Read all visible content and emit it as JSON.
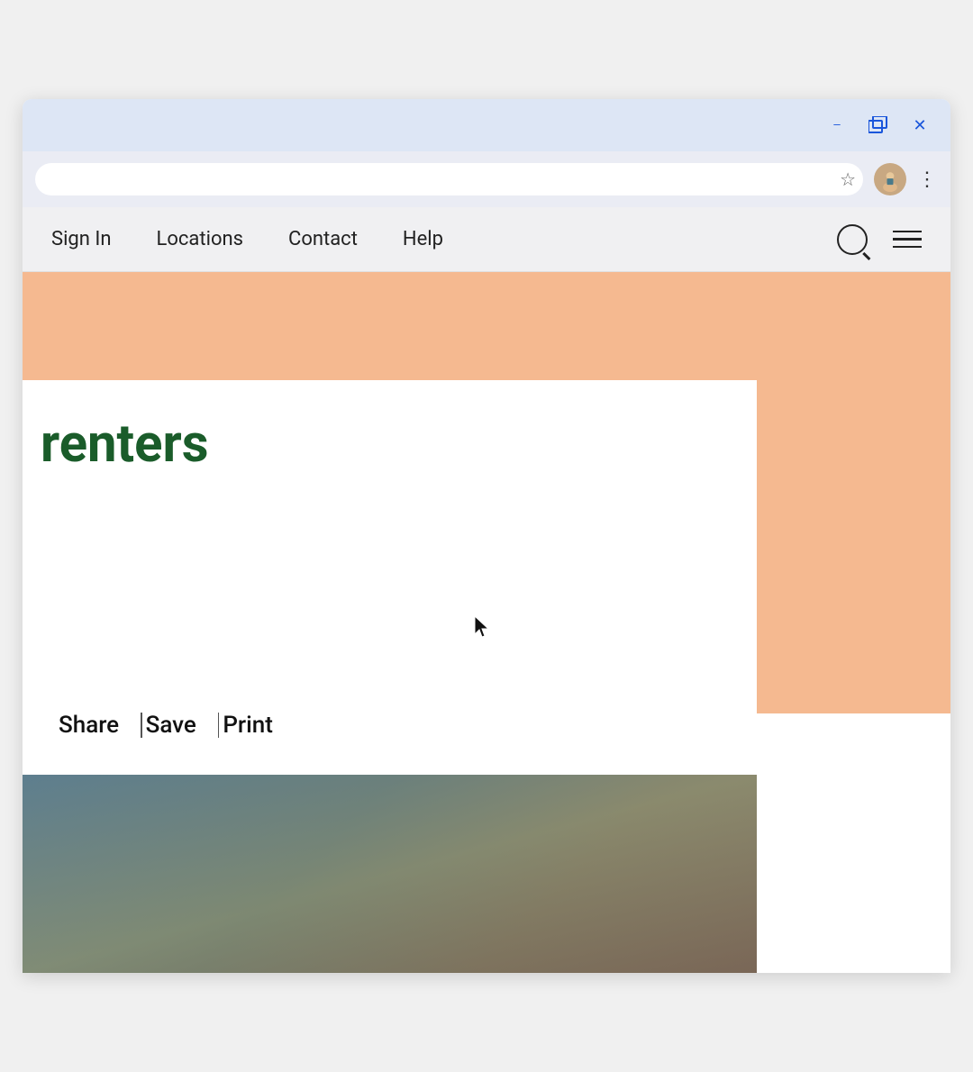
{
  "browser": {
    "title_bar": {
      "minimize_label": "−",
      "restore_label": "⧉",
      "close_label": "✕"
    },
    "address_bar": {
      "placeholder": ""
    }
  },
  "site_nav": {
    "items": [
      {
        "id": "sign-in",
        "label": "Sign In"
      },
      {
        "id": "locations",
        "label": "Locations"
      },
      {
        "id": "contact",
        "label": "Contact"
      },
      {
        "id": "help",
        "label": "Help"
      }
    ]
  },
  "page": {
    "hero_title": "renters",
    "action_links": [
      {
        "id": "share",
        "label": "Share"
      },
      {
        "id": "save",
        "label": "Save"
      },
      {
        "id": "print",
        "label": "Print"
      }
    ]
  },
  "colors": {
    "green": "#1a5c2a",
    "orange": "#f5b990",
    "nav_bg": "#f0f0f2",
    "title_bar_bg": "#dde6f5",
    "address_bar_bg": "#eaecf4"
  }
}
